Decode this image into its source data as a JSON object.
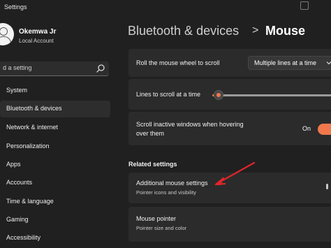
{
  "window": {
    "title": "Settings"
  },
  "user": {
    "name": "Okemwa Jr",
    "account_type": "Local Account"
  },
  "search": {
    "placeholder": "d a setting"
  },
  "sidebar": {
    "items": [
      {
        "label": "System"
      },
      {
        "label": "Bluetooth & devices",
        "active": true
      },
      {
        "label": "Network & internet"
      },
      {
        "label": "Personalization"
      },
      {
        "label": "Apps"
      },
      {
        "label": "Accounts"
      },
      {
        "label": "Time & language"
      },
      {
        "label": "Gaming"
      },
      {
        "label": "Accessibility"
      }
    ]
  },
  "header": {
    "parent": "Bluetooth & devices",
    "separator": ">",
    "title": "Mouse"
  },
  "settings": {
    "scroll_wheel": {
      "label": "Roll the mouse wheel to scroll",
      "value": "Multiple lines at a time"
    },
    "lines_to_scroll": {
      "label": "Lines to scroll at a time",
      "level": 0.03
    },
    "scroll_inactive": {
      "label_line1": "Scroll inactive windows when hovering",
      "label_line2": "over them",
      "state_label": "On",
      "enabled": true
    }
  },
  "related": {
    "heading": "Related settings",
    "items": [
      {
        "title": "Additional mouse settings",
        "subtitle": "Pointer icons and visibility"
      },
      {
        "title": "Mouse pointer",
        "subtitle": "Pointer size and color"
      }
    ]
  },
  "colors": {
    "accent": "#f0784c",
    "annotation_arrow": "#e0262b",
    "background": "#202020",
    "card": "#2b2b2b"
  },
  "icons": {
    "search": "search-icon",
    "dropdown": "chevron-down-icon",
    "breadcrumb_separator": "chevron-right-icon",
    "annotation": "red-arrow-annotation"
  }
}
